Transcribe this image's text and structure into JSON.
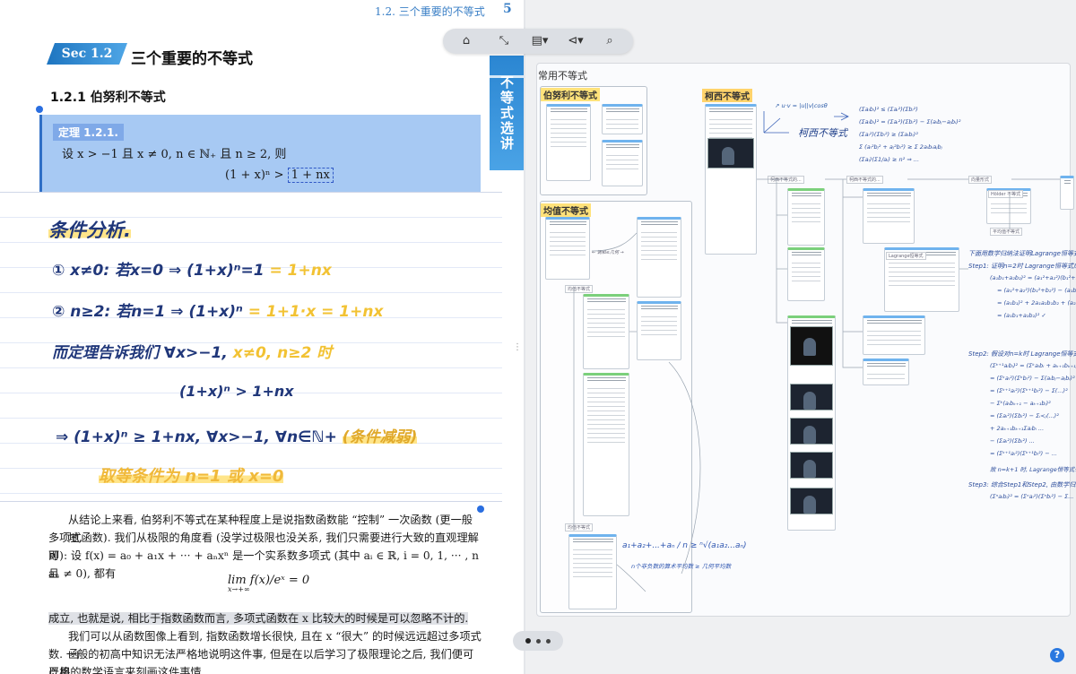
{
  "page_header": {
    "section_title": "1.2.  三个重要的不等式",
    "page_number": "5"
  },
  "section": {
    "badge": "Sec 1.2",
    "title": "三个重要的不等式",
    "subsection": "1.2.1   伯努利不等式",
    "side_tab": "不等式选讲"
  },
  "theorem": {
    "label": "定理 1.2.1.",
    "statement": "设 x > −1 且 x ≠ 0, n ∈ ℕ₊ 且 n ≥ 2, 则",
    "formula_left": "(1 + x)ⁿ > ",
    "formula_boxed": "1 + nx"
  },
  "handwritten_notes": {
    "heading": "条件分析.",
    "line1": "① x≠0: 若x=0 ⇒ (1+x)ⁿ=1 ",
    "line1_hl": "= 1+nx",
    "line2": "② n≥2: 若n=1 ⇒ (1+x)ⁿ ",
    "line2_hl": "= 1+1·x = 1+nx",
    "line3": "而定理告诉我们 ∀x>−1, ",
    "line3_hl": "x≠0, n≥2 时",
    "line4": "(1+x)ⁿ > 1+nx",
    "line5": "⇒ (1+x)ⁿ ≥ 1+nx, ∀x>−1, ∀n∈ℕ+ ",
    "line5_hl": "(条件减弱)",
    "line6": "取等条件为 n=1 或 x=0"
  },
  "body": {
    "para1_a": "从结论上来看, 伯努利不等式在某种程度上是说指数函数能 “控制” 一次函数 (更一般地,",
    "para1_b": "多项式函数). 我们从极限的角度看 (没学过极限也没关系, 我们只需要进行大致的直观理解即",
    "para1_c": "可): 设 f(x) = a₀ + a₁x + ··· + aₙxⁿ 是一个实系数多项式 (其中 aᵢ ∈ ℝ, i = 0, 1, ··· , n 且",
    "para1_d": "aₙ ≠ 0), 都有",
    "limit": "lim  f(x)/eˣ = 0",
    "limit_sub": "x→+∞",
    "para2_a": "成立, 也就是说, 相比于指数函数而言, 多项式函数在 x 比较大的时候是可以忽略不计的.",
    "para3_a": "我们可以从函数图像上看到, 指数函数增长很快, 且在 x “很大” 的时候远远超过多项式函",
    "para3_b": "数. 一般的初高中知识无法严格地说明这件事, 但是在以后学习了极限理论之后, 我们便可以用",
    "para3_c": "严格的数学语言来刻画这件事情."
  },
  "toolbar": {
    "home": "home-icon",
    "collapse": "collapse-arrows-icon",
    "page": "page-icon",
    "share": "share-icon",
    "search": "search-icon"
  },
  "mindmap": {
    "title": "常用不等式",
    "groups": {
      "bernoulli": "伯努利不等式",
      "mean": "均值不等式",
      "cauchy": "柯西不等式"
    },
    "cauchy_hw_title": "柯西不等式",
    "hw_line1": "下面用数学归纳法证明Lagrange恒等式",
    "hw_step1": "Step1: 证明n=2时 Lagrange恒等式成立",
    "hw_step2": "Step2: 假设对n=k时 Lagrange恒等式成立",
    "hw_step3": "Step3: 综合Step1和Step2, 由数学归纳",
    "node_labels": [
      "柯西不等式的...",
      "柯西不等式的...",
      "向量形式",
      "Lagrange恒等式",
      "Hölder 不等式",
      "平均值不等式"
    ]
  },
  "pager": {
    "dots": 3,
    "active": 0
  },
  "help": "?"
}
